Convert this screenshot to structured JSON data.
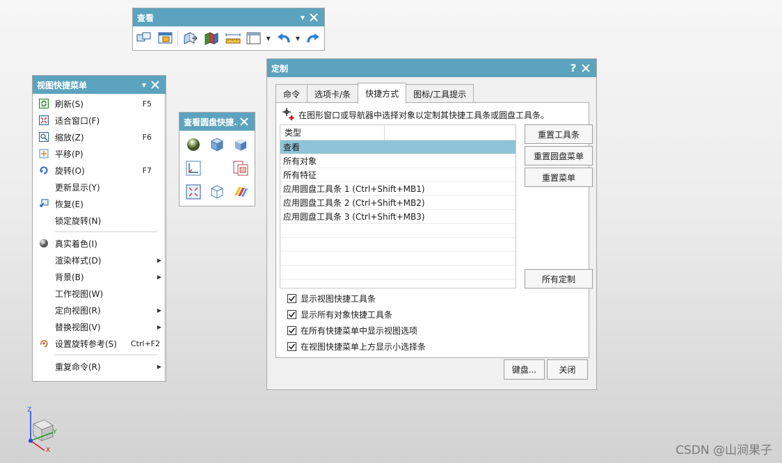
{
  "view_toolbar": {
    "title": "查看",
    "tools": [
      {
        "icon": "fit-window-icon"
      },
      {
        "icon": "zoom-region-icon"
      },
      {
        "icon": "clip-section-icon"
      },
      {
        "icon": "section-view-icon"
      },
      {
        "icon": "measure-icon"
      },
      {
        "icon": "window-layout-icon"
      },
      {
        "icon": "undo-icon"
      },
      {
        "icon": "redo-icon"
      }
    ]
  },
  "quick_menu": {
    "title": "视图快捷菜单",
    "items": [
      {
        "label": "刷新(S)",
        "shortcut": "F5",
        "icon": "refresh-icon",
        "submenu": false
      },
      {
        "label": "适合窗口(F)",
        "shortcut": "",
        "icon": "fit-icon",
        "submenu": false
      },
      {
        "label": "缩放(Z)",
        "shortcut": "F6",
        "icon": "zoom-icon",
        "submenu": false
      },
      {
        "label": "平移(P)",
        "shortcut": "",
        "icon": "pan-icon",
        "submenu": false
      },
      {
        "label": "旋转(O)",
        "shortcut": "F7",
        "icon": "rotate-icon",
        "submenu": false
      },
      {
        "label": "更新显示(Y)",
        "shortcut": "",
        "icon": "",
        "submenu": false
      },
      {
        "label": "恢复(E)",
        "shortcut": "",
        "icon": "restore-icon",
        "submenu": false
      },
      {
        "label": "锁定旋转(N)",
        "shortcut": "",
        "icon": "",
        "submenu": false
      },
      {
        "separator": true
      },
      {
        "label": "真实着色(I)",
        "shortcut": "",
        "icon": "true-shading-icon",
        "submenu": false
      },
      {
        "label": "渲染样式(D)",
        "shortcut": "",
        "icon": "",
        "submenu": true
      },
      {
        "label": "背景(B)",
        "shortcut": "",
        "icon": "",
        "submenu": true
      },
      {
        "label": "工作视图(W)",
        "shortcut": "",
        "icon": "",
        "submenu": false
      },
      {
        "label": "定向视图(R)",
        "shortcut": "",
        "icon": "",
        "submenu": true
      },
      {
        "label": "替换视图(V)",
        "shortcut": "",
        "icon": "",
        "submenu": true
      },
      {
        "label": "设置旋转参考(S)",
        "shortcut": "Ctrl+F2",
        "icon": "rotation-reference-icon",
        "submenu": false
      },
      {
        "separator": true
      },
      {
        "label": "重复命令(R)",
        "shortcut": "",
        "icon": "",
        "submenu": true
      }
    ]
  },
  "radial_panel": {
    "title": "查看圆盘快捷...",
    "icons": [
      "shaded-sphere-icon",
      "shaded-cube-icon",
      "shaded-edges-cube-icon",
      "orient-axis-icon",
      "",
      "layout-icon",
      "fit-icon",
      "wireframe-cube-icon",
      "studio-shading-icon"
    ]
  },
  "customize_dialog": {
    "title": "定制",
    "tabs": [
      "命令",
      "选项卡/条",
      "快捷方式",
      "图标/工具提示"
    ],
    "active_tab": 2,
    "hint": "在图形窗口或导航器中选择对象以定制其快捷工具条或圆盘工具条。",
    "table": {
      "header": "类型",
      "rows": [
        "查看",
        "所有对象",
        "所有特征",
        "应用圆盘工具条 1 (Ctrl+Shift+MB1)",
        "应用圆盘工具条 2 (Ctrl+Shift+MB2)",
        "应用圆盘工具条 3 (Ctrl+Shift+MB3)"
      ],
      "selected_row": 0
    },
    "buttons": {
      "reset_toolbar": "重置工具条",
      "reset_radial": "重置圆盘菜单",
      "reset_menu": "重置菜单",
      "all_customize": "所有定制",
      "keyboard": "键盘...",
      "close": "关闭"
    },
    "checkboxes": [
      {
        "label": "显示视图快捷工具条",
        "checked": true
      },
      {
        "label": "显示所有对象快捷工具条",
        "checked": true
      },
      {
        "label": "在所有快捷菜单中显示视图选项",
        "checked": true
      },
      {
        "label": "在视图快捷菜单上方显示小选择条",
        "checked": true
      }
    ]
  },
  "triad": {
    "x": "X",
    "y": "Y",
    "z": "Z"
  },
  "watermark": "CSDN @山涧果子"
}
